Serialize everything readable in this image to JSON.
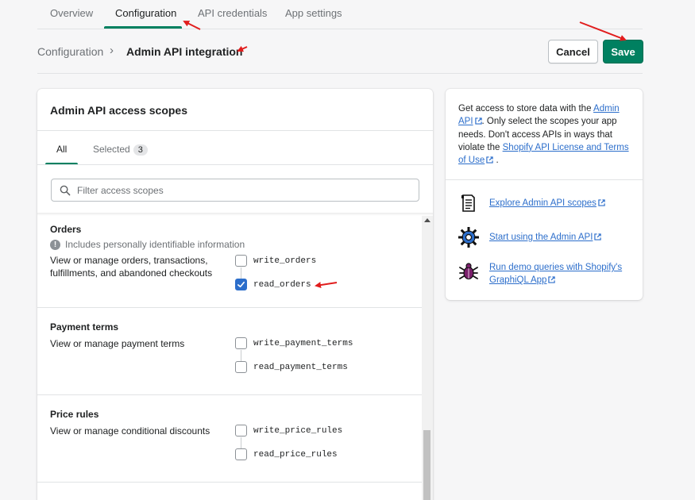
{
  "tabs": [
    {
      "label": "Overview"
    },
    {
      "label": "Configuration"
    },
    {
      "label": "API credentials"
    },
    {
      "label": "App settings"
    }
  ],
  "breadcrumb": {
    "parent": "Configuration",
    "separator": "›",
    "current": "Admin API integration"
  },
  "actions": {
    "cancel_label": "Cancel",
    "save_label": "Save"
  },
  "scopes_card": {
    "title": "Admin API access scopes",
    "subtabs": {
      "all_label": "All",
      "selected_label": "Selected",
      "selected_count": "3"
    },
    "search_placeholder": "Filter access scopes",
    "sections": [
      {
        "title": "Orders",
        "note": "Includes personally identifiable information",
        "description": "View or manage orders, transactions, fulfillments, and abandoned checkouts",
        "scopes": [
          {
            "label": "write_orders",
            "checked": false
          },
          {
            "label": "read_orders",
            "checked": true
          }
        ]
      },
      {
        "title": "Payment terms",
        "description": "View or manage payment terms",
        "scopes": [
          {
            "label": "write_payment_terms",
            "checked": false
          },
          {
            "label": "read_payment_terms",
            "checked": false
          }
        ]
      },
      {
        "title": "Price rules",
        "description": "View or manage conditional discounts",
        "scopes": [
          {
            "label": "write_price_rules",
            "checked": false
          },
          {
            "label": "read_price_rules",
            "checked": false
          }
        ]
      }
    ]
  },
  "info_card": {
    "intro_1": "Get access to store data with the ",
    "intro_link_1": "Admin API",
    "intro_2": ". Only select the scopes your app needs. Don't access APIs in ways that violate the ",
    "intro_link_2": "Shopify API License and Terms of Use",
    "intro_3": ".",
    "resources": [
      {
        "label": "Explore Admin API scopes",
        "icon": "document-icon"
      },
      {
        "label": "Start using the Admin API",
        "icon": "gear-icon"
      },
      {
        "label": "Run demo queries with Shopify's GraphiQL App",
        "icon": "graphiql-bug-icon"
      }
    ]
  },
  "colors": {
    "accent": "#008060",
    "link": "#2c6ecb",
    "checkbox": "#2c6ecb",
    "annotation": "#e11d1d"
  }
}
